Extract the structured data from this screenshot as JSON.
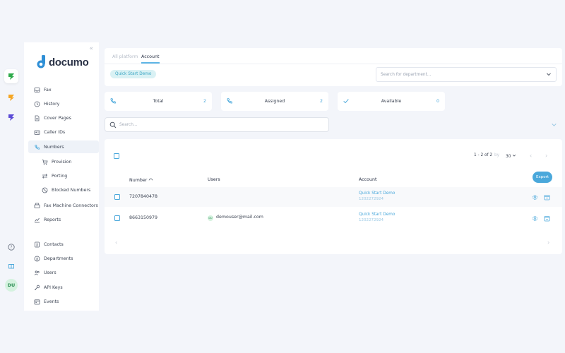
{
  "rail": {
    "avatar_initials": "DU"
  },
  "sidebar": {
    "logo_text": "documo",
    "items": [
      {
        "label": "Fax",
        "icon": "inbox-icon"
      },
      {
        "label": "History",
        "icon": "history-icon"
      },
      {
        "label": "Cover Pages",
        "icon": "document-icon"
      },
      {
        "label": "Caller IDs",
        "icon": "id-card-icon"
      },
      {
        "label": "Numbers",
        "icon": "phone-icon",
        "active": true
      },
      {
        "label": "Provision",
        "icon": "cart-icon"
      },
      {
        "label": "Porting",
        "icon": "transfer-icon"
      },
      {
        "label": "Blocked Numbers",
        "icon": "block-icon"
      },
      {
        "label": "Fax Machine Connectors",
        "icon": "fax-machine-icon"
      },
      {
        "label": "Reports",
        "icon": "chart-icon"
      },
      {
        "label": "Contacts",
        "icon": "contacts-icon"
      },
      {
        "label": "Departments",
        "icon": "departments-icon"
      },
      {
        "label": "Users",
        "icon": "users-icon"
      },
      {
        "label": "API Keys",
        "icon": "key-icon"
      },
      {
        "label": "Events",
        "icon": "calendar-icon"
      }
    ]
  },
  "tabs": {
    "all_platform": "All platform",
    "account": "Account"
  },
  "filters": {
    "chip": "Quick Start Demo",
    "department_placeholder": "Search for department..."
  },
  "stats": [
    {
      "label": "Total",
      "value": "2"
    },
    {
      "label": "Assigned",
      "value": "2"
    },
    {
      "label": "Available",
      "value": "0"
    }
  ],
  "search": {
    "placeholder": "Search..."
  },
  "table": {
    "pager_range": "1 - 2 of 2",
    "per_page": "30",
    "headers": {
      "number": "Number",
      "users": "Users",
      "account": "Account"
    },
    "export_label": "Export",
    "rows": [
      {
        "number": "7207840478",
        "user": "",
        "user_initials": "",
        "account_name": "Quick Start Demo",
        "account_id": "1202272924"
      },
      {
        "number": "8663150979",
        "user": "demouser@mail.com",
        "user_initials": "DU",
        "account_name": "Quick Start Demo",
        "account_id": "1202272924"
      }
    ]
  },
  "colors": {
    "accent": "#4aa8db",
    "brand_green": "#2eaa4a",
    "brand_orange": "#f5a623",
    "brand_purple": "#5b4bd6",
    "background": "#f3f5fa"
  }
}
